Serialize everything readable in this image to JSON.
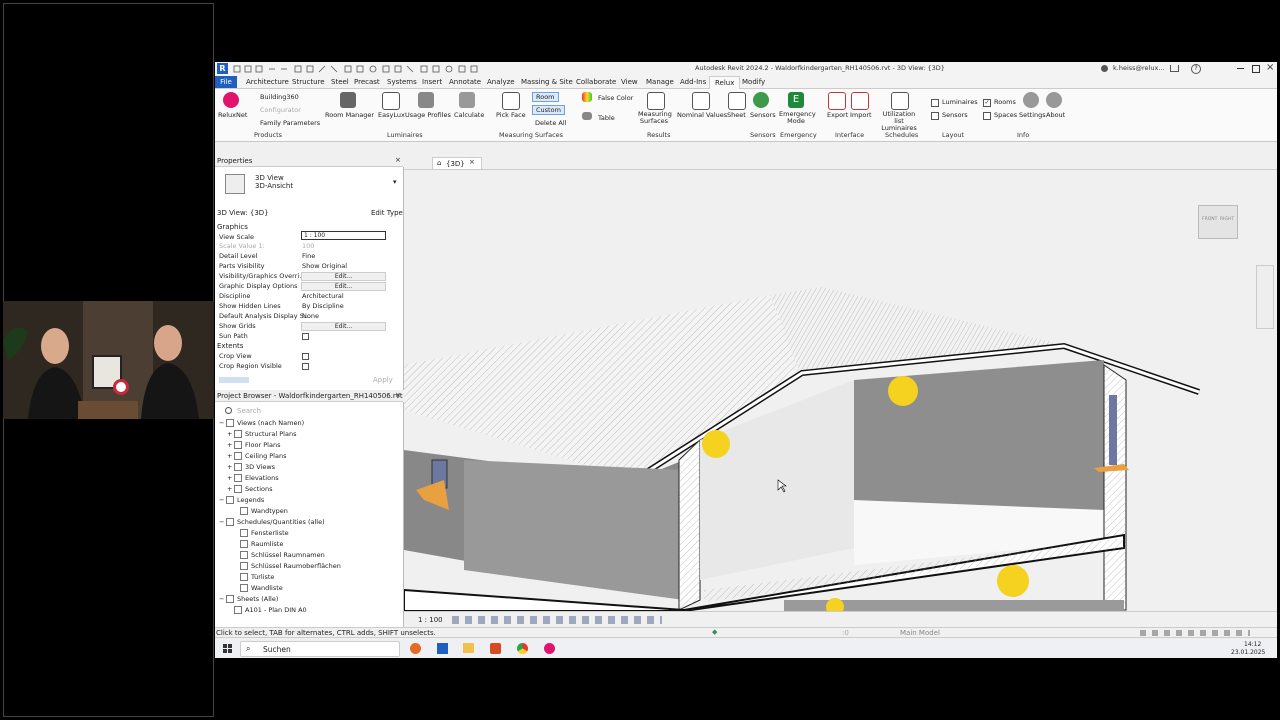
{
  "window": {
    "title": "Autodesk Revit 2024.2 - Waldorfkindergarten_RH140506.rvt - 3D View: {3D}",
    "user": "k.heiss@relux...",
    "logo_letter": "R"
  },
  "menu_tabs": [
    "File",
    "Architecture",
    "Structure",
    "Steel",
    "Precast",
    "Systems",
    "Insert",
    "Annotate",
    "Analyze",
    "Massing & Site",
    "Collaborate",
    "View",
    "Manage",
    "Add-Ins",
    "Relux",
    "Modify"
  ],
  "ribbon": {
    "reluxnet": "ReluxNet",
    "building360": "Building360",
    "configurator": "Configurator",
    "family_parameters": "Family Parameters",
    "products_group": "Products",
    "room_manager": "Room Manager",
    "easylux": "EasyLux",
    "usage_profiles": "Usage Profiles",
    "calculate": "Calculate",
    "luminaires_group": "Luminaires",
    "pick_face": "Pick Face",
    "room": "Room",
    "custom": "Custom",
    "delete_all": "Delete All",
    "measuring_surfaces_group": "Measuring Surfaces",
    "false_color": "False Color",
    "table": "Table",
    "measuring_surfaces": "Measuring Surfaces",
    "nominal_values": "Nominal Values",
    "sheet": "Sheet",
    "results_group": "Results",
    "sensors": "Sensors",
    "sensors_group": "Sensors",
    "emergency_mode": "Emergency Mode",
    "emergency_group": "Emergency",
    "export": "Export",
    "import": "Import",
    "interface_group": "Interface",
    "utilization_list": "Utilization list Luminaires",
    "schedules_group": "Schedules",
    "cb_luminaires": "Luminaires",
    "cb_sensors": "Sensors",
    "cb_rooms": "Rooms",
    "cb_spaces": "Spaces",
    "layout_group": "Layout",
    "settings": "Settings",
    "about": "About",
    "info_group": "Info"
  },
  "properties": {
    "header": "Properties",
    "type_name": "3D View",
    "type_sub": "3D-Ansicht",
    "selector": "3D View: {3D}",
    "edit_type": "Edit Type",
    "section_graphics": "Graphics",
    "section_extents": "Extents",
    "apply": "Apply",
    "edit_label": "Edit...",
    "rows": [
      {
        "label": "View Scale",
        "value": "1 : 100"
      },
      {
        "label": "Scale Value    1:",
        "value": "100"
      },
      {
        "label": "Detail Level",
        "value": "Fine"
      },
      {
        "label": "Parts Visibility",
        "value": "Show Original"
      },
      {
        "label": "Visibility/Graphics Overri...",
        "value": ""
      },
      {
        "label": "Graphic Display Options",
        "value": ""
      },
      {
        "label": "Discipline",
        "value": "Architectural"
      },
      {
        "label": "Show Hidden Lines",
        "value": "By Discipline"
      },
      {
        "label": "Default Analysis Display S...",
        "value": "None"
      },
      {
        "label": "Show Grids",
        "value": ""
      },
      {
        "label": "Sun Path",
        "value": ""
      }
    ],
    "extent_rows": [
      {
        "label": "Crop View"
      },
      {
        "label": "Crop Region Visible"
      }
    ]
  },
  "browser": {
    "header": "Project Browser - Waldorfkindergarten_RH140506.rvt",
    "search_placeholder": "Search",
    "items": [
      {
        "text": "Views (nach Namen)",
        "level": 0,
        "exp": "−"
      },
      {
        "text": "Structural Plans",
        "level": 1,
        "exp": "+"
      },
      {
        "text": "Floor Plans",
        "level": 1,
        "exp": "+"
      },
      {
        "text": "Ceiling Plans",
        "level": 1,
        "exp": "+"
      },
      {
        "text": "3D Views",
        "level": 1,
        "exp": "+"
      },
      {
        "text": "Elevations",
        "level": 1,
        "exp": "+"
      },
      {
        "text": "Sections",
        "level": 1,
        "exp": "+"
      },
      {
        "text": "Legends",
        "level": 0,
        "exp": "−"
      },
      {
        "text": "Wandtypen",
        "level": 2,
        "exp": ""
      },
      {
        "text": "Schedules/Quantities (alle)",
        "level": 0,
        "exp": "−"
      },
      {
        "text": "Fensterliste",
        "level": 2,
        "exp": ""
      },
      {
        "text": "Raumliste",
        "level": 2,
        "exp": ""
      },
      {
        "text": "Schlüssel Raumnamen",
        "level": 2,
        "exp": ""
      },
      {
        "text": "Schlüssel Raumoberflächen",
        "level": 2,
        "exp": ""
      },
      {
        "text": "Türliste",
        "level": 2,
        "exp": ""
      },
      {
        "text": "Wandliste",
        "level": 2,
        "exp": ""
      },
      {
        "text": "Sheets (Alle)",
        "level": 0,
        "exp": "−"
      },
      {
        "text": "A101 - Plan DIN A0",
        "level": 1,
        "exp": ""
      }
    ]
  },
  "view_tab": "{3D}",
  "viewcube": {
    "front": "FRONT",
    "right": "RIGHT"
  },
  "view_scale_bar": "1 : 100",
  "status": {
    "hint": "Click to select, TAB for alternates, CTRL adds, SHIFT unselects.",
    "model": "Main Model",
    "count": ":0"
  },
  "taskbar": {
    "search": "Suchen",
    "time": "14:12",
    "date": "23.01.2025"
  },
  "colors": {
    "relux_accent": "#e0146e",
    "lamp": "#f4d21f"
  }
}
